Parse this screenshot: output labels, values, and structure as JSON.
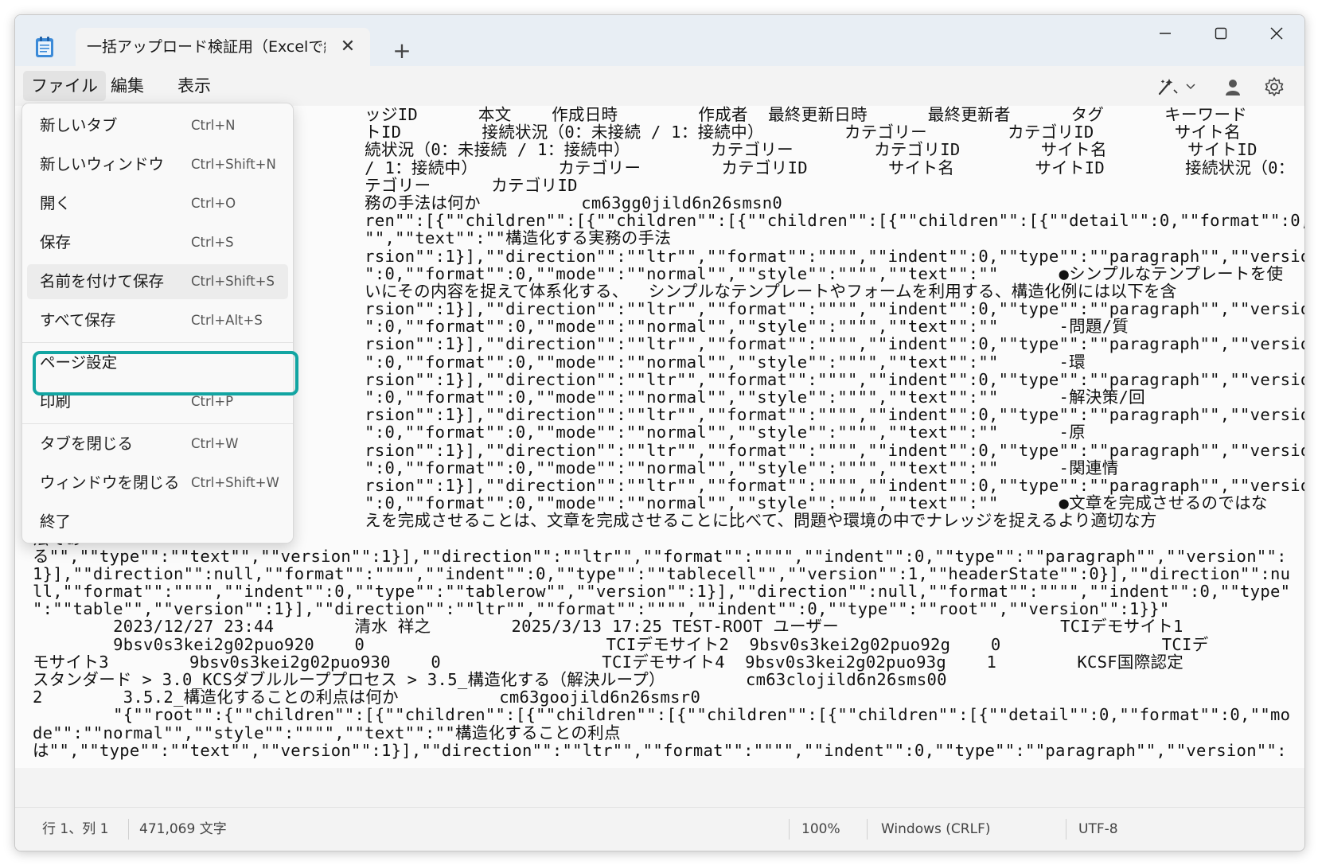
{
  "window": {
    "tab_title": "一括アップロード検証用（Excelで編集・",
    "tab_close_glyph": "✕",
    "new_tab_glyph": "+"
  },
  "menubar": {
    "file": "ファイル",
    "edit": "編集",
    "view": "表示"
  },
  "icons": {
    "app": "notepad-icon",
    "copilot": "copilot-icon",
    "account": "account-icon",
    "settings": "gear-icon"
  },
  "file_menu": {
    "items": [
      {
        "label": "新しいタブ",
        "shortcut": "Ctrl+N"
      },
      {
        "label": "新しいウィンドウ",
        "shortcut": "Ctrl+Shift+N"
      },
      {
        "label": "開く",
        "shortcut": "Ctrl+O"
      },
      {
        "label": "保存",
        "shortcut": "Ctrl+S"
      },
      {
        "label": "名前を付けて保存",
        "shortcut": "Ctrl+Shift+S"
      },
      {
        "label": "すべて保存",
        "shortcut": "Ctrl+Alt+S"
      },
      {
        "label": "ページ設定",
        "shortcut": ""
      },
      {
        "label": "印刷",
        "shortcut": "Ctrl+P"
      },
      {
        "label": "タブを閉じる",
        "shortcut": "Ctrl+W"
      },
      {
        "label": "ウィンドウを閉じる",
        "shortcut": "Ctrl+Shift+W"
      },
      {
        "label": "終了",
        "shortcut": ""
      }
    ],
    "highlighted_item": "名前を付けて保存",
    "highlight_color": "#12a5a2"
  },
  "editor": {
    "lines": [
      "                                 ッジID      本文    作成日時        作成者  最終更新日時      最終更新者      タグ      キーワード",
      "                                 トID        接続状況（0：未接続 / 1：接続中）        カテゴリー        カテゴリID        サイト名",
      "                                 続状況（0：未接続 / 1：接続中）        カテゴリー        カテゴリID        サイト名        サイトID",
      "                                 / 1：接続中）        カテゴリー        カテゴリID        サイト名        サイトID        接続状況（0：",
      "                                 テゴリー      カテゴリID",
      "                                 務の手法は何か          cm63gg0jild6n26smsn0",
      "                                 ren\"\":[{\"\"children\"\":[{\"\"children\"\":[{\"\"children\"\":[{\"\"children\"\":[{\"\"detail\"\":0,\"\"format\"\":0,\"\"mo",
      "                                 \"\",\"\"text\"\":\"\"構造化する実務の手法",
      "                                 rsion\"\":1}],\"\"direction\"\":\"\"ltr\"\",\"\"format\"\":\"\"\"\",\"\"indent\"\":0,\"\"type\"\":\"\"paragraph\"\",\"\"version\"\":",
      "                                 \":0,\"\"format\"\":0,\"\"mode\"\":\"\"normal\"\",\"\"style\"\":\"\"\"\",\"\"text\"\":\"\"      ●シンプルなテンプレートを使",
      "                                 いにその内容を捉えて体系化する、  シンプルなテンプレートやフォームを利用する、構造化例には以下を含",
      "                                 rsion\"\":1}],\"\"direction\"\":\"\"ltr\"\",\"\"format\"\":\"\"\"\",\"\"indent\"\":0,\"\"type\"\":\"\"paragraph\"\",\"\"version\"\":",
      "                                 \":0,\"\"format\"\":0,\"\"mode\"\":\"\"normal\"\",\"\"style\"\":\"\"\"\",\"\"text\"\":\"\"      -問題/質",
      "                                 rsion\"\":1}],\"\"direction\"\":\"\"ltr\"\",\"\"format\"\":\"\"\"\",\"\"indent\"\":0,\"\"type\"\":\"\"paragraph\"\",\"\"version\"\":",
      "                                 \":0,\"\"format\"\":0,\"\"mode\"\":\"\"normal\"\",\"\"style\"\":\"\"\"\",\"\"text\"\":\"\"      -環",
      "                                 rsion\"\":1}],\"\"direction\"\":\"\"ltr\"\",\"\"format\"\":\"\"\"\",\"\"indent\"\":0,\"\"type\"\":\"\"paragraph\"\",\"\"version\"\":",
      "                                 \":0,\"\"format\"\":0,\"\"mode\"\":\"\"normal\"\",\"\"style\"\":\"\"\"\",\"\"text\"\":\"\"      -解決策/回",
      "                                 rsion\"\":1}],\"\"direction\"\":\"\"ltr\"\",\"\"format\"\":\"\"\"\",\"\"indent\"\":0,\"\"type\"\":\"\"paragraph\"\",\"\"version\"\":",
      "                                 \":0,\"\"format\"\":0,\"\"mode\"\":\"\"normal\"\",\"\"style\"\":\"\"\"\",\"\"text\"\":\"\"      -原",
      "                                 rsion\"\":1}],\"\"direction\"\":\"\"ltr\"\",\"\"format\"\":\"\"\"\",\"\"indent\"\":0,\"\"type\"\":\"\"paragraph\"\",\"\"version\"\":",
      "                                 \":0,\"\"format\"\":0,\"\"mode\"\":\"\"normal\"\",\"\"style\"\":\"\"\"\",\"\"text\"\":\"\"      -関連情",
      "                                 rsion\"\":1}],\"\"direction\"\":\"\"ltr\"\",\"\"format\"\":\"\"\"\",\"\"indent\"\":0,\"\"type\"\":\"\"paragraph\"\",\"\"version\"\":",
      "                                 \":0,\"\"format\"\":0,\"\"mode\"\":\"\"normal\"\",\"\"style\"\":\"\"\"\",\"\"text\"\":\"\"      ●文章を完成させるのではな",
      "                                 えを完成させることは、文章を完成させることに比べて、問題や環境の中でナレッジを捉えるより適切な方",
      "法であ",
      "る\"\",\"\"type\"\":\"\"text\"\",\"\"version\"\":1}],\"\"direction\"\":\"\"ltr\"\",\"\"format\"\":\"\"\"\",\"\"indent\"\":0,\"\"type\"\":\"\"paragraph\"\",\"\"version\"\":",
      "1}],\"\"direction\"\":null,\"\"format\"\":\"\"\"\",\"\"indent\"\":0,\"\"type\"\":\"\"tablecell\"\",\"\"version\"\":1,\"\"headerState\"\":0}],\"\"direction\"\":nu",
      "ll,\"\"format\"\":\"\"\"\",\"\"indent\"\":0,\"\"type\"\":\"\"tablerow\"\",\"\"version\"\":1}],\"\"direction\"\":null,\"\"format\"\":\"\"\"\",\"\"indent\"\":0,\"\"type\"",
      "\":\"\"table\"\",\"\"version\"\":1}],\"\"direction\"\":\"\"ltr\"\",\"\"format\"\":\"\"\"\",\"\"indent\"\":0,\"\"type\"\":\"\"root\"\",\"\"version\"\":1}}\"",
      "        2023/12/27 23:44        清水 祥之        2025/3/13 17:25 TEST-ROOT ユーザー                      TCIデモサイト1",
      "        9bsv0s3kei2g02puo920    0                        TCIデモサイト2  9bsv0s3kei2g02puo92g    0                TCIデ",
      "モサイト3        9bsv0s3kei2g02puo930    0                TCIデモサイト4  9bsv0s3kei2g02puo93g    1        KCSF国際認定",
      "スタンダード > 3.0_KCSダブルループプロセス > 3.5_構造化する（解決ループ）        cm63clojild6n26sms00",
      "2        3.5.2_構造化することの利点は何か          cm63goojild6n26smsr0",
      "        \"{\"\"root\"\":{\"\"children\"\":[{\"\"children\"\":[{\"\"children\"\":[{\"\"children\"\":[{\"\"children\"\":[{\"\"detail\"\":0,\"\"format\"\":0,\"\"mo",
      "de\"\":\"\"normal\"\",\"\"style\"\":\"\"\"\",\"\"text\"\":\"\"構造化することの利点",
      "は\"\",\"\"type\"\":\"\"text\"\",\"\"version\"\":1}],\"\"direction\"\":\"\"ltr\"\",\"\"format\"\":\"\"\"\",\"\"indent\"\":0,\"\"type\"\":\"\"paragraph\"\",\"\"version\"\":"
    ]
  },
  "statusbar": {
    "position": "行 1、列 1",
    "char_count": "471,069 文字",
    "zoom": "100%",
    "line_ending": "Windows (CRLF)",
    "encoding": "UTF-8"
  }
}
